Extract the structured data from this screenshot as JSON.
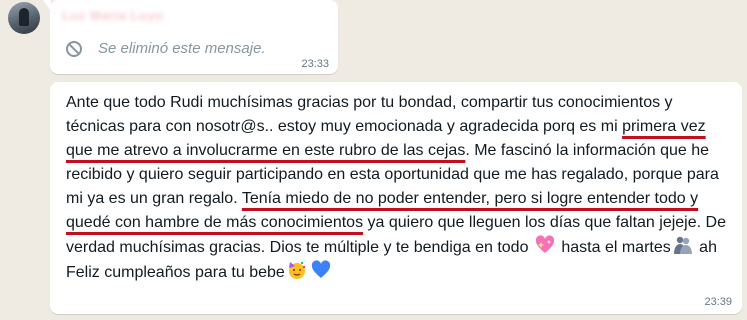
{
  "chat": {
    "message1": {
      "sender": "Luz Maria Luyo",
      "deleted_text": "Se eliminó este mensaje.",
      "time": "23:33",
      "icon": "ban-icon"
    },
    "message2": {
      "part1": "Ante que todo Rudi muchísimas gracias por tu bondad, compartir tus conocimientos y técnicas para con nosotr@s.. estoy muy emocionada y agradecida porq es mi ",
      "highlight1": "primera vez que me atrevo a involucrarme en este rubro de las cejas",
      "part2": ". Me fascinó la información que he recibido y quiero seguir participando en esta oportunidad que me has regalado, porque para mi ya es un gran regalo. ",
      "highlight2": "Tenía miedo de no poder entender, pero si logre entender todo y quedé con hambre de más conocimientos",
      "part3": " ya quiero que lleguen los días que faltan jejeje. De verdad muchísimas gracias. Dios te múltiple y te bendiga en todo ",
      "part4": " hasta el martes",
      "part5": " ah Feliz cumpleaños para tu bebe",
      "emojis": [
        "sparkling-heart",
        "people-hugging",
        "partying-face",
        "blue-heart"
      ],
      "highlight_color": "#c40d1e",
      "time": "23:39"
    }
  },
  "colors": {
    "background": "#efeae2",
    "bubble": "#ffffff",
    "meta_text": "#667781",
    "deleted_text": "#8696a0"
  }
}
